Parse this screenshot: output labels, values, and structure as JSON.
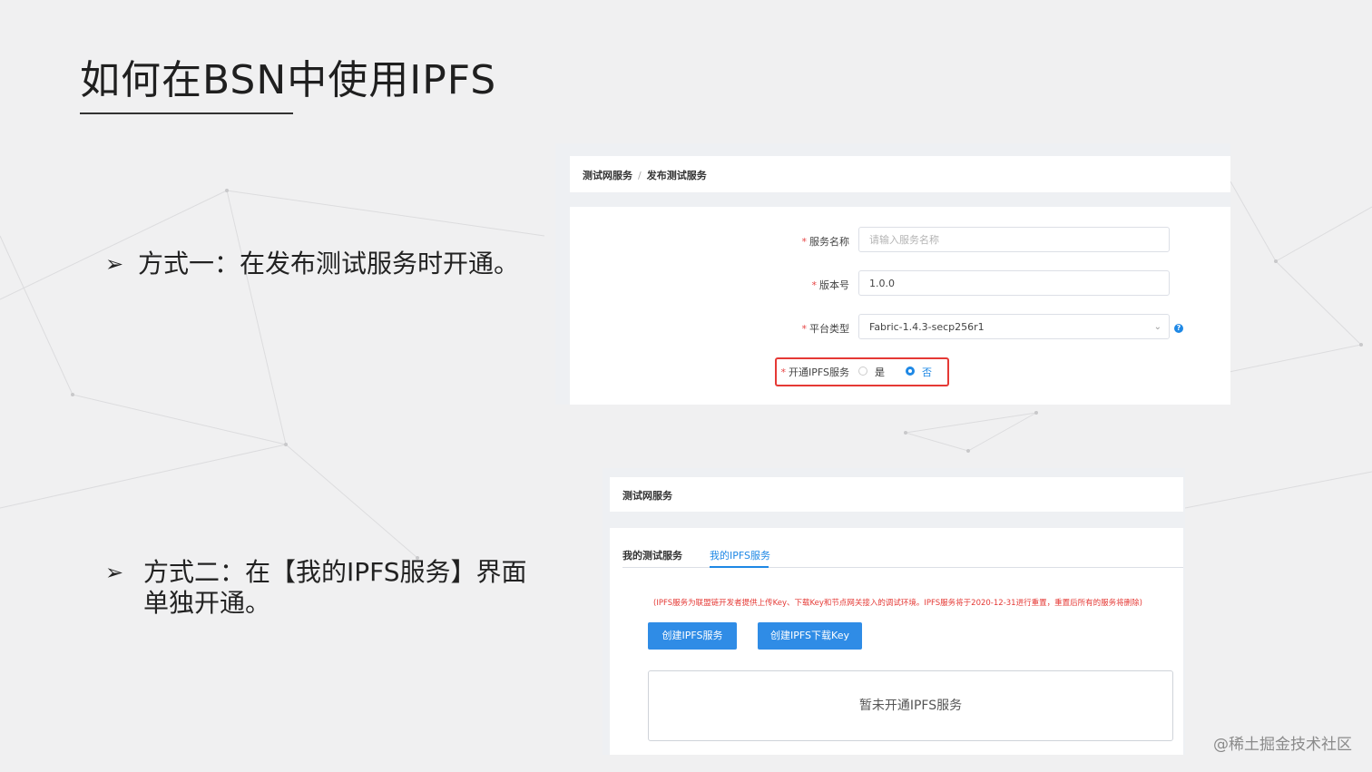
{
  "slide": {
    "title": "如何在BSN中使用IPFS",
    "bullet1": "方式一：在发布测试服务时开通。",
    "bullet2": "方式二：在【我的IPFS服务】界面单独开通。",
    "bullet_marker": "➢",
    "watermark": "@稀土掘金技术社区"
  },
  "form_screenshot": {
    "breadcrumb": {
      "item1": "测试网服务",
      "separator": "/",
      "item2": "发布测试服务"
    },
    "fields": {
      "service_name_label": "服务名称",
      "service_name_placeholder": "请输入服务名称",
      "version_label": "版本号",
      "version_value": "1.0.0",
      "platform_label": "平台类型",
      "platform_value": "Fabric-1.4.3-secp256r1",
      "ipfs_label": "开通IPFS服务",
      "ipfs_option_yes": "是",
      "ipfs_option_no": "否",
      "ipfs_selected": "否",
      "required_mark": "*"
    },
    "help_icon": "question-circle-icon"
  },
  "ipfs_screenshot": {
    "header": "测试网服务",
    "tabs": [
      {
        "label": "我的测试服务",
        "active": false
      },
      {
        "label": "我的IPFS服务",
        "active": true
      }
    ],
    "notice": "(IPFS服务为联盟链开发者提供上传Key、下载Key和节点网关接入的调试环境。IPFS服务将于2020-12-31进行重置，重置后所有的服务将删除)",
    "create_service_button": "创建IPFS服务",
    "create_key_button": "创建IPFS下载Key",
    "empty_text": "暂未开通IPFS服务"
  },
  "colors": {
    "accent": "#2f8ce6",
    "highlight": "#e53935",
    "background": "#f0f0f1"
  }
}
